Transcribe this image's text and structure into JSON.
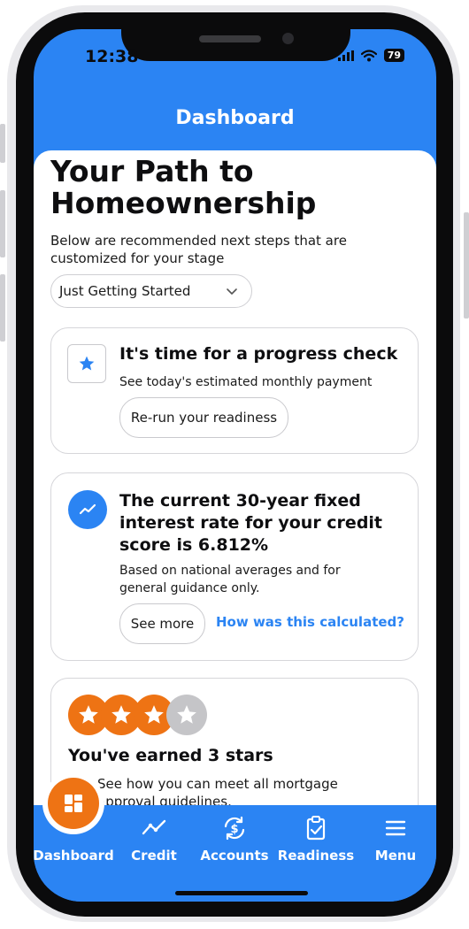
{
  "status_bar": {
    "time": "12:38",
    "battery": "79"
  },
  "header": {
    "title": "Dashboard"
  },
  "page": {
    "title": "Your Path to Homeownership",
    "subtitle": "Below are recommended next steps that are customized for your stage",
    "stage_select": {
      "value": "Just Getting Started"
    }
  },
  "cards": {
    "progress": {
      "title": "It's time for a progress check",
      "text": "See today's estimated monthly payment",
      "button": "Re-run your readiness",
      "icon": "star-icon"
    },
    "rate": {
      "title": "The current 30-year fixed interest rate for your credit score is 6.812%",
      "text": "Based on national averages and for general guidance only.",
      "button": "See more",
      "link": "How was this calculated?",
      "icon": "trend-icon"
    },
    "stars": {
      "earned": 3,
      "total": 4,
      "title": "You've earned 3 stars",
      "text": "See how you can meet all mortgage approval guidelines."
    }
  },
  "bottom_nav": {
    "items": [
      {
        "label": "Dashboard",
        "icon": "dashboard-icon"
      },
      {
        "label": "Credit",
        "icon": "credit-trend-icon"
      },
      {
        "label": "Accounts",
        "icon": "accounts-dollar-icon"
      },
      {
        "label": "Readiness",
        "icon": "clipboard-check-icon"
      },
      {
        "label": "Menu",
        "icon": "menu-icon"
      }
    ]
  },
  "colors": {
    "primary": "#2b84f3",
    "accent": "#ee7314",
    "star_inactive": "#c5c5c8"
  }
}
